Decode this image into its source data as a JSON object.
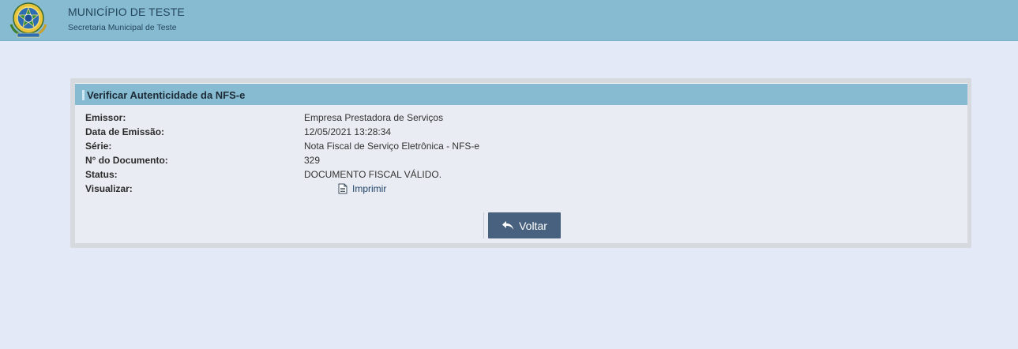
{
  "header": {
    "org_name": "MUNICÍPIO DE TESTE",
    "org_subtitle": "Secretaria Municipal de Teste",
    "crest_icon": "coat-of-arms-icon"
  },
  "panel": {
    "title": "Verificar Autenticidade da NFS-e",
    "rows": [
      {
        "label": "Emissor:",
        "value": "Empresa Prestadora de Serviços"
      },
      {
        "label": "Data de Emissão:",
        "value": "12/05/2021 13:28:34"
      },
      {
        "label": "Série:",
        "value": "Nota Fiscal de Serviço Eletrônica - NFS-e"
      },
      {
        "label": "N° do Documento:",
        "value": "329"
      },
      {
        "label": "Status:",
        "value": "DOCUMENTO FISCAL VÁLIDO."
      },
      {
        "label": "Visualizar:",
        "value": ""
      }
    ],
    "print_link": {
      "label": "Imprimir",
      "icon": "document-icon"
    },
    "back_button": {
      "label": "Voltar",
      "icon": "reply-arrow-icon"
    }
  },
  "colors": {
    "page_background": "#e3e9f7",
    "header_bar": "#87bbd1",
    "panel_background": "#e9ecf2",
    "button": "#47617f"
  }
}
